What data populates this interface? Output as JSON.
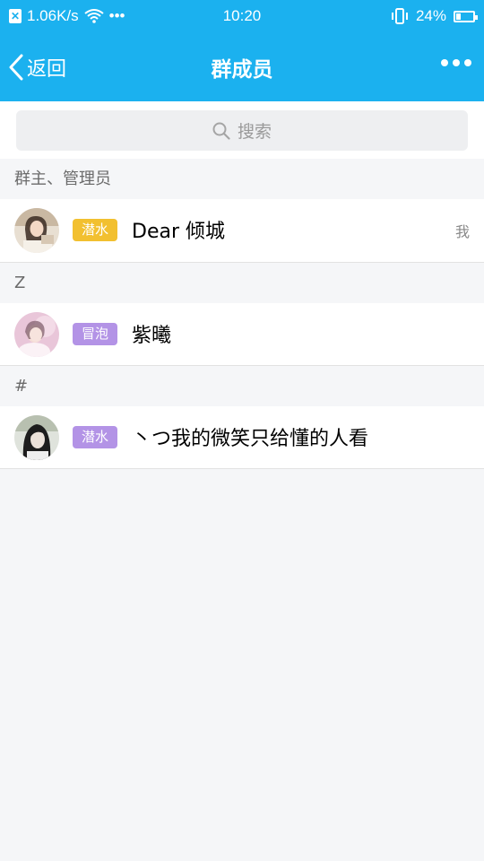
{
  "status_bar": {
    "speed": "1.06K/s",
    "dots": "•••",
    "time": "10:20",
    "battery": "24%"
  },
  "header": {
    "back_label": "返回",
    "title": "群成员"
  },
  "search": {
    "placeholder": "搜索"
  },
  "sections": [
    {
      "title": "群主、管理员",
      "members": [
        {
          "badge": "潜水",
          "badge_color": "#f2c030",
          "name": "Dear 倾城",
          "tag": "我"
        }
      ]
    },
    {
      "title": "Z",
      "members": [
        {
          "badge": "冒泡",
          "badge_color": "#b393e6",
          "name": "紫曦"
        }
      ]
    },
    {
      "title": "#",
      "members": [
        {
          "badge": "潜水",
          "badge_color": "#b393e6",
          "name": "丶つ我的微笑只给懂的人看"
        }
      ]
    }
  ],
  "colors": {
    "primary": "#1bb1ef",
    "badge_yellow": "#f2c030",
    "badge_purple": "#b393e6"
  }
}
